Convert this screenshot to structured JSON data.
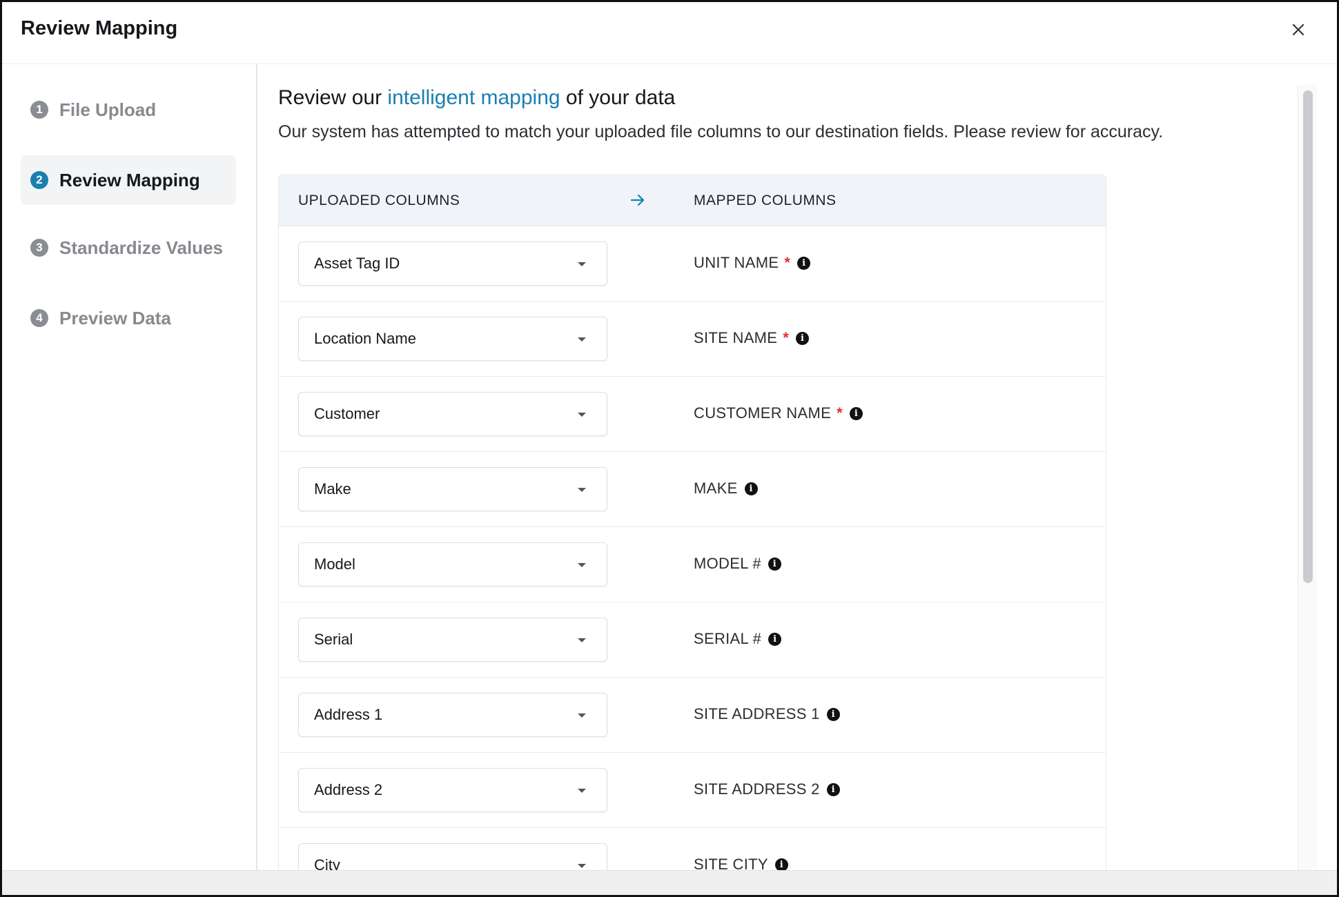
{
  "dialog": {
    "title": "Review Mapping"
  },
  "steps": [
    {
      "num": "1",
      "label": "File Upload",
      "active": false
    },
    {
      "num": "2",
      "label": "Review Mapping",
      "active": true
    },
    {
      "num": "3",
      "label": "Standardize Values",
      "active": false
    },
    {
      "num": "4",
      "label": "Preview Data",
      "active": false
    }
  ],
  "content": {
    "title_pre": "Review our ",
    "title_highlight": "intelligent mapping",
    "title_post": " of your data",
    "description": "Our system has attempted to match your uploaded file columns to our destination fields. Please review for accuracy."
  },
  "table": {
    "uploaded_header": "UPLOADED COLUMNS",
    "mapped_header": "MAPPED COLUMNS",
    "rows": [
      {
        "uploaded": "Asset Tag ID",
        "mapped": "UNIT NAME",
        "required": true
      },
      {
        "uploaded": "Location Name",
        "mapped": "SITE NAME",
        "required": true
      },
      {
        "uploaded": "Customer",
        "mapped": "CUSTOMER NAME",
        "required": true
      },
      {
        "uploaded": "Make",
        "mapped": "MAKE",
        "required": false
      },
      {
        "uploaded": "Model",
        "mapped": "MODEL #",
        "required": false
      },
      {
        "uploaded": "Serial",
        "mapped": "SERIAL #",
        "required": false
      },
      {
        "uploaded": "Address 1",
        "mapped": "SITE ADDRESS 1",
        "required": false
      },
      {
        "uploaded": "Address 2",
        "mapped": "SITE ADDRESS 2",
        "required": false
      },
      {
        "uploaded": "City",
        "mapped": "SITE CITY",
        "required": false
      }
    ]
  },
  "colors": {
    "accent": "#1a7fb0",
    "required": "#e0332f",
    "inactive_step": "#868a8f"
  }
}
